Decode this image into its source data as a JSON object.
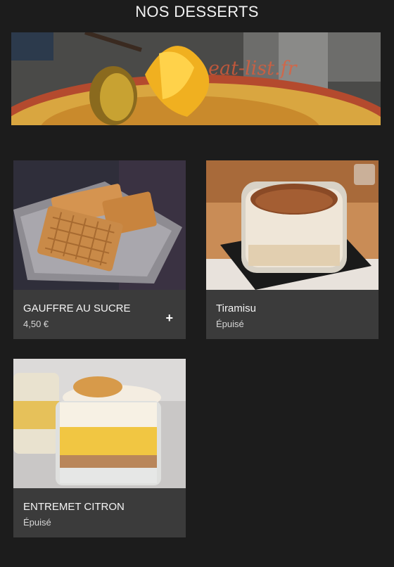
{
  "header": {
    "title": "NOS DESSERTS"
  },
  "hero": {
    "watermark": "eat-list.fr",
    "image_desc": "crème brûlée with caramelized pineapple"
  },
  "products": [
    {
      "name": "GAUFFRE AU SUCRE",
      "price": "4,50 €",
      "action": "+"
    },
    {
      "name": "Tiramisu",
      "status": "Épuisé"
    },
    {
      "name": "ENTREMET CITRON",
      "status": "Épuisé"
    }
  ],
  "colors": {
    "background": "#1c1c1c",
    "card": "#3b3b3b",
    "watermark": "#e65c37"
  }
}
